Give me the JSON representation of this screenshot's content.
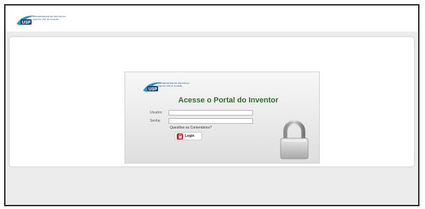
{
  "header": {
    "logo_name": "usp-logo",
    "logo_acronym": "USP",
    "logo_line1": "UNIVERSIDADE DE SÃO PAULO",
    "logo_line2": "Agência USP de Inovação"
  },
  "login": {
    "title": "Acesse o Portal do Inventor",
    "username_label": "Usuário:",
    "username_value": "",
    "password_label": "Senha:",
    "password_value": "",
    "questions_link": "Questões ou Comentários?",
    "login_button": "Login",
    "login_icon": "lock-icon",
    "decoration_icon": "padlock-icon"
  },
  "colors": {
    "title_green": "#2e6e2a",
    "logo_blue": "#22457a",
    "logo_accent": "#1e9bd7",
    "button_red": "#d22027"
  }
}
